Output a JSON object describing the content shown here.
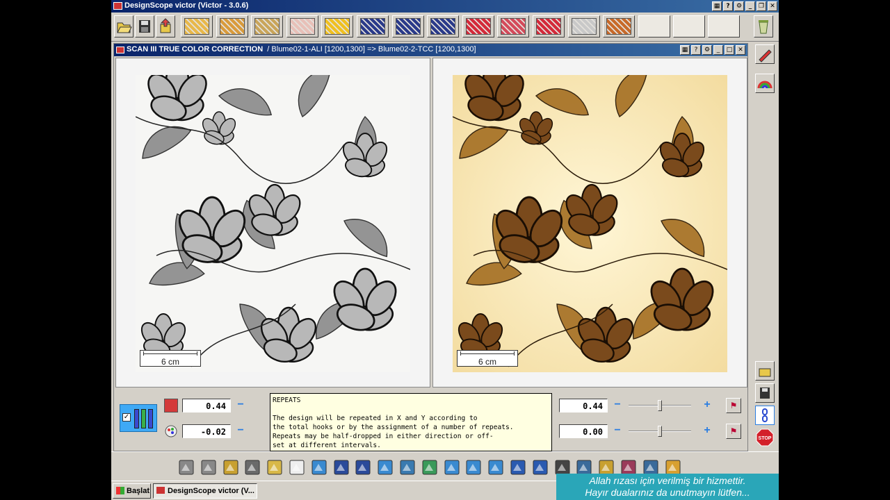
{
  "window": {
    "title": "DesignScope victor (Victor - 3.0.6)"
  },
  "child": {
    "title_bold": "SCAN III   TRUE COLOR CORRECTION",
    "title_rest": "/ Blume02-1-ALI [1200,1300] => Blume02-2-TCC [1200,1300]"
  },
  "panes": {
    "left_scale": "6 cm",
    "right_scale": "6 cm"
  },
  "controls": {
    "left_row1_value": "0.44",
    "left_row2_value": "-0.02",
    "right_row1_value": "0.44",
    "right_row2_value": "0.00",
    "minus": "−",
    "plus": "+",
    "stop_label": "STOP",
    "slider_levels": {
      "right_row1": 0.5,
      "right_row2": 0.5
    },
    "colors": {
      "red": "#d43a3a",
      "accent": "#3fa9f5"
    }
  },
  "tooltip": {
    "title": "REPEATS",
    "lines": [
      "The design will be repeated in X and Y according to",
      "the total hooks or by the assignment of a number of repeats.",
      "Repeats may be half-dropped in either direction or off-",
      "set at different intervals."
    ]
  },
  "taskbar": {
    "start_label": "Başlat",
    "task_label": "DesignScope victor (V..."
  },
  "banner": {
    "line1": "Allah rızası için verilmiş bir hizmettir.",
    "line2": "Hayır dualarınız da unutmayın lütfen..."
  },
  "toolbar_top_swatches": [
    "#e8b84a",
    "#d99b3c",
    "#c9a55a",
    "#e8c0b8",
    "#f0c020",
    "#2a3a8a",
    "#2a3a8a",
    "#2a3a8a",
    "#d42a3a",
    "#d44a5a",
    "#d42a3a",
    "#c8c8c8",
    "#c86a2a"
  ],
  "icons": {
    "top": [
      "open-folder-icon",
      "save-icon",
      "export-icon"
    ],
    "right": [
      "marker-icon",
      "rainbow-icon",
      "load-icon",
      "save-icon",
      "chain-icon",
      "stop-icon"
    ],
    "bottom": [
      "pencil-icon",
      "brush-icon",
      "palette-grid-icon",
      "camera-icon",
      "tag-icon",
      "page-icon",
      "filter-icon",
      "columns-icon",
      "repeat-icon",
      "rotate-icon",
      "pattern-icon",
      "grid-icon",
      "weave-icon",
      "chart-icon",
      "texture-icon",
      "runner-icon",
      "scale-icon",
      "printer-icon",
      "machine-icon",
      "loom-icon",
      "fabric-icon",
      "card-icon",
      "pencil-color-icon"
    ]
  }
}
